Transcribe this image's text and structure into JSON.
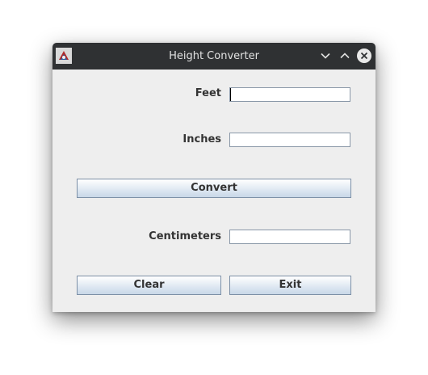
{
  "window": {
    "title": "Height Converter"
  },
  "form": {
    "feet_label": "Feet",
    "feet_value": "",
    "inches_label": "Inches",
    "inches_value": "",
    "convert_label": "Convert",
    "centimeters_label": "Centimeters",
    "centimeters_value": "",
    "clear_label": "Clear",
    "exit_label": "Exit"
  },
  "icons": {
    "app": "java-app-icon",
    "minimize": "chevron-down-icon",
    "maximize": "chevron-up-icon",
    "close": "close-icon"
  },
  "colors": {
    "titlebar": "#2f3133",
    "window_bg": "#eeeeee",
    "button_border": "#7c8fa6"
  }
}
